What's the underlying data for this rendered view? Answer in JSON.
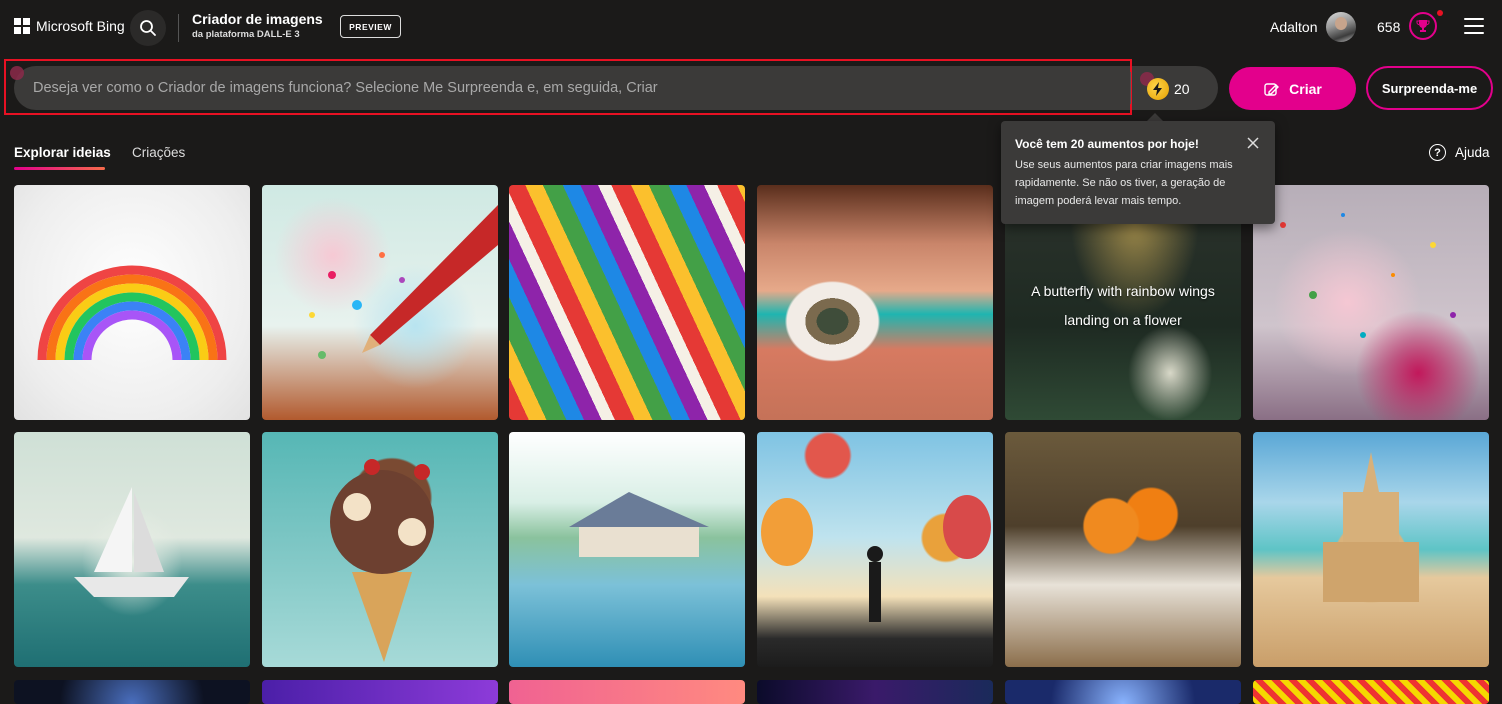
{
  "header": {
    "brand": "Microsoft Bing",
    "app_title": "Criador de imagens",
    "app_subtitle": "da plataforma DALL-E 3",
    "badge": "PREVIEW",
    "user_name": "Adalton",
    "points": "658"
  },
  "prompt": {
    "placeholder": "Deseja ver como o Criador de imagens funciona? Selecione Me Surpreenda e, em seguida, Criar",
    "value": "",
    "boosts": "20",
    "create_label": "Criar",
    "surprise_label": "Surpreenda-me"
  },
  "tabs": {
    "explore": "Explorar ideias",
    "creations": "Criações",
    "help": "Ajuda"
  },
  "tooltip": {
    "title": "Você tem 20 aumentos por hoje!",
    "body": "Use seus aumentos para criar imagens mais rapidamente. Se não os tiver, a geração de imagem poderá levar mais tempo."
  },
  "gallery": {
    "hover_caption": "A butterfly with rainbow wings landing on a flower"
  },
  "colors": {
    "accent": "#e3008c",
    "background": "#1b1a19",
    "highlight": "#e81123"
  },
  "icons": [
    "windows-logo-icon",
    "search-icon",
    "trophy-icon",
    "menu-icon",
    "boost-icon",
    "create-icon",
    "help-icon",
    "close-icon"
  ]
}
